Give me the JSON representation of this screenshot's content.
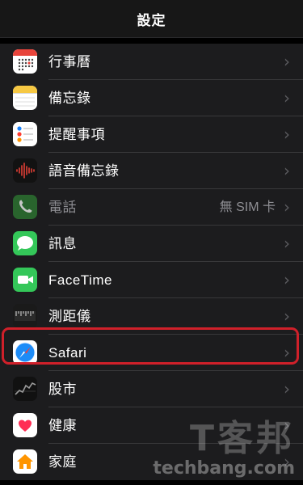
{
  "header": {
    "title": "設定"
  },
  "rows": [
    {
      "label": "行事曆",
      "icon": "calendar-icon"
    },
    {
      "label": "備忘錄",
      "icon": "notes-icon"
    },
    {
      "label": "提醒事項",
      "icon": "reminders-icon"
    },
    {
      "label": "語音備忘錄",
      "icon": "voice-memos-icon"
    },
    {
      "label": "電話",
      "icon": "phone-icon",
      "value": "無 SIM 卡",
      "dimmed": true
    },
    {
      "label": "訊息",
      "icon": "messages-icon"
    },
    {
      "label": "FaceTime",
      "icon": "facetime-icon"
    },
    {
      "label": "測距儀",
      "icon": "measure-icon"
    },
    {
      "label": "Safari",
      "icon": "safari-icon",
      "highlighted": true
    },
    {
      "label": "股市",
      "icon": "stocks-icon"
    },
    {
      "label": "健康",
      "icon": "health-icon"
    },
    {
      "label": "家庭",
      "icon": "home-icon"
    }
  ],
  "chevron": "›",
  "colors": {
    "highlight": "#d0202a",
    "row_bg": "#1c1c1e",
    "nav_bg": "#171717"
  },
  "watermark": {
    "cjk": "T客邦",
    "url": "techbang.com"
  }
}
